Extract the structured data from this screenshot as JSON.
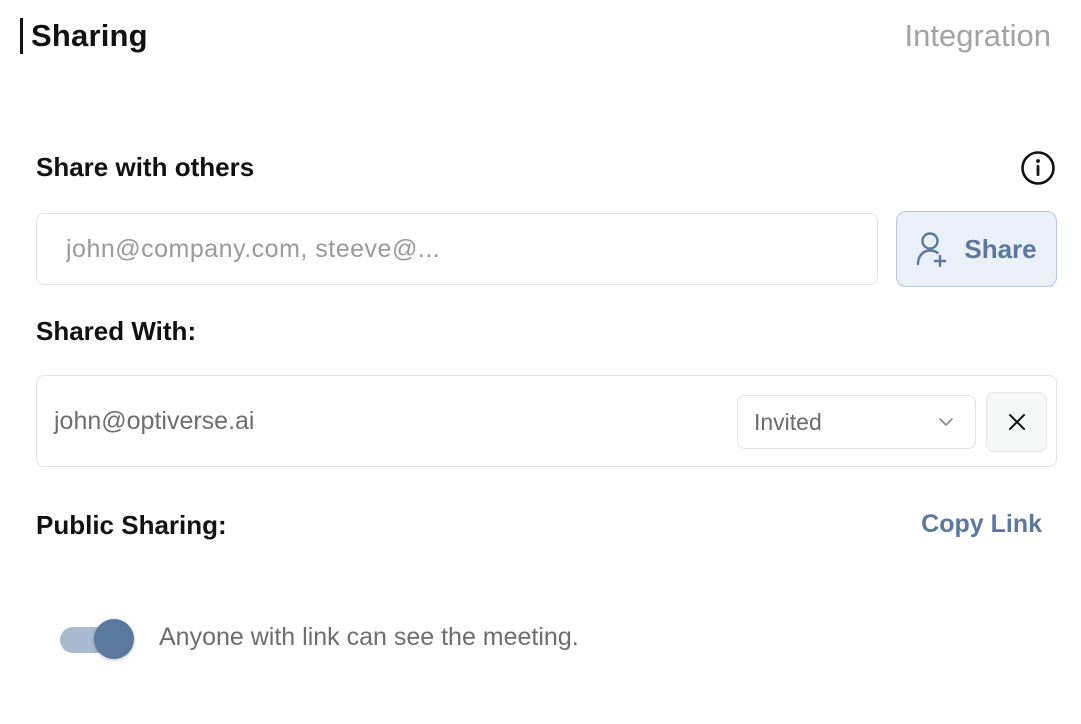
{
  "tabs": {
    "active_label": "Sharing",
    "inactive_label": "Integration"
  },
  "share_section": {
    "title": "Share with others",
    "email_placeholder": "john@company.com, steeve@...",
    "share_button_label": "Share"
  },
  "shared_with": {
    "title": "Shared With:",
    "entries": [
      {
        "email": "john@optiverse.ai",
        "status": "Invited"
      }
    ]
  },
  "public_sharing": {
    "title": "Public Sharing:",
    "copy_link_label": "Copy Link",
    "toggle_on": true,
    "toggle_label": "Anyone with link can see the meeting."
  },
  "colors": {
    "accent": "#5b78a0",
    "accent_light": "#a9b9cf",
    "button_bg": "#eaeff8"
  },
  "icons": {
    "info": "info-circle-icon",
    "share": "add-user-icon",
    "dropdown": "chevron-down-icon",
    "remove": "close-icon"
  }
}
